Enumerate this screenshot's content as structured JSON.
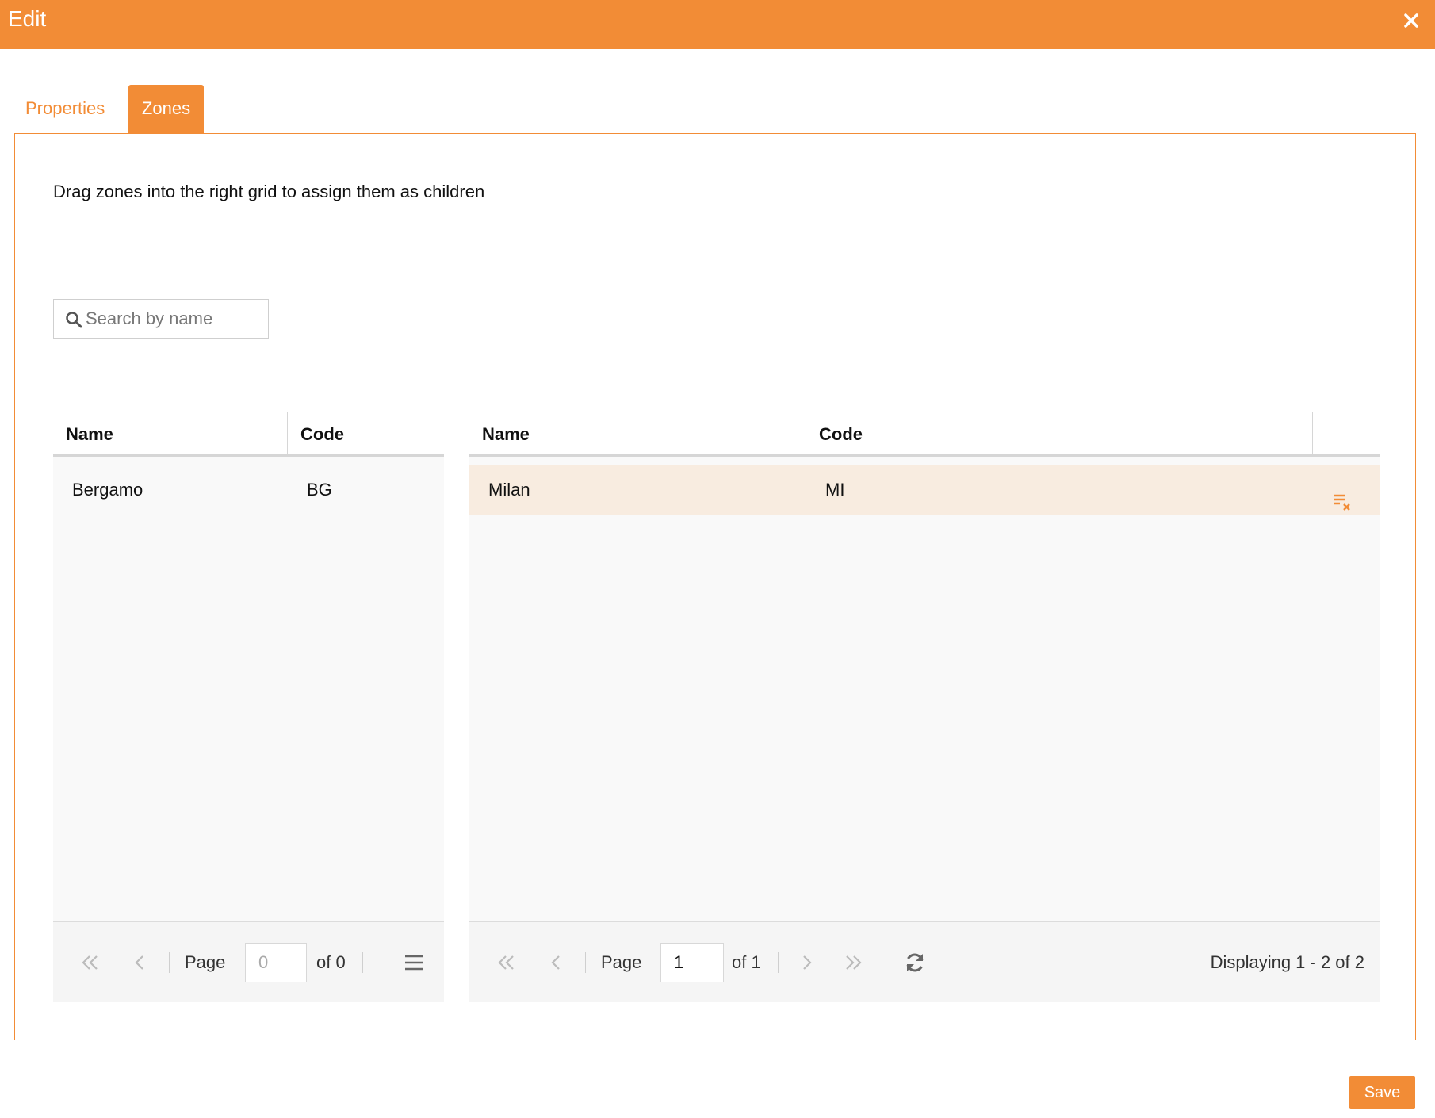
{
  "window": {
    "title": "Edit"
  },
  "tabs": [
    {
      "label": "Properties",
      "active": false
    },
    {
      "label": "Zones",
      "active": true
    }
  ],
  "instructions": "Drag zones into the right grid to assign them as children",
  "search": {
    "placeholder": "Search by name",
    "value": ""
  },
  "left_grid": {
    "columns": [
      "Name",
      "Code"
    ],
    "rows": [
      {
        "name": "Bergamo",
        "code": "BG"
      }
    ],
    "pager": {
      "page_label": "Page",
      "page_value": "0",
      "of_label": "of 0"
    }
  },
  "right_grid": {
    "columns": [
      "Name",
      "Code"
    ],
    "rows": [
      {
        "name": "Milan",
        "code": "MI"
      }
    ],
    "pager": {
      "page_label": "Page",
      "page_value": "1",
      "of_label": "of 1",
      "displaying": "Displaying 1 - 2 of 2"
    }
  },
  "actions": {
    "save_label": "Save"
  },
  "colors": {
    "accent": "#f28c36",
    "selected_row": "#f8ece0",
    "grid_bg": "#f9f9f9"
  },
  "icons": [
    "close-icon",
    "search-icon",
    "first-page-icon",
    "prev-page-icon",
    "next-page-icon",
    "last-page-icon",
    "refresh-icon",
    "menu-icon",
    "remove-row-icon"
  ]
}
